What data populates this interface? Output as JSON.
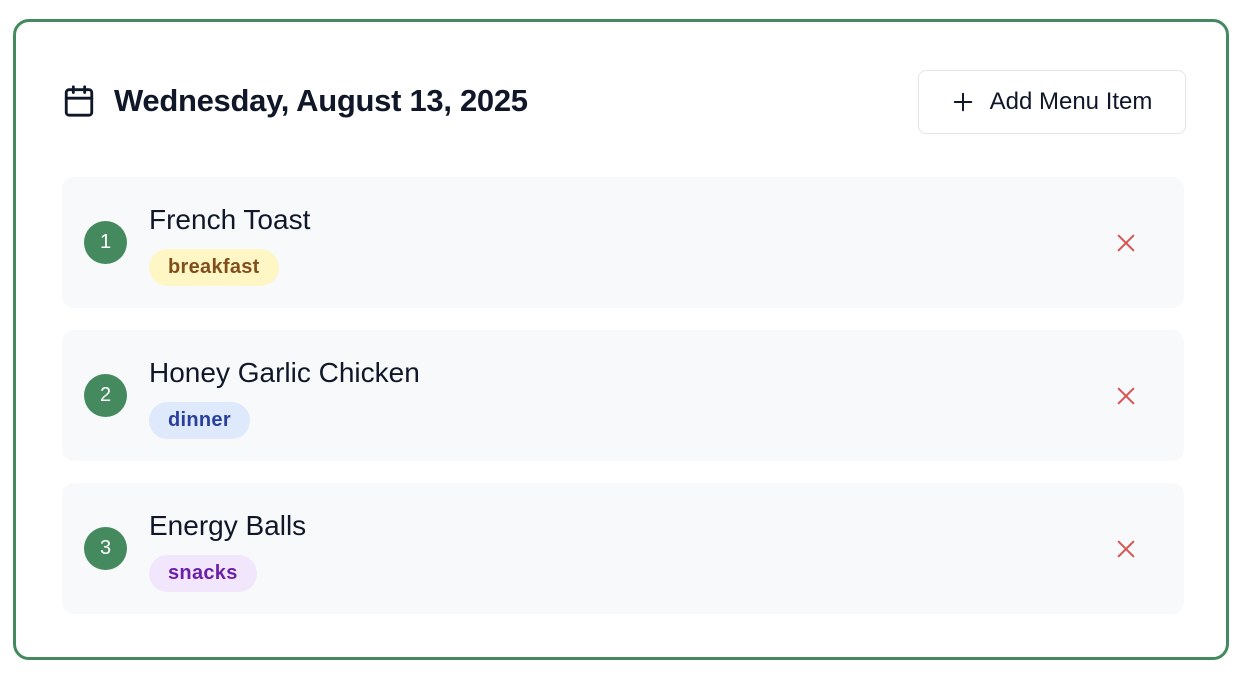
{
  "header": {
    "date": "Wednesday, August 13, 2025",
    "add_button_label": "Add Menu Item",
    "calendar_icon": "calendar-icon",
    "add_icon": "plus-icon"
  },
  "menu_items": [
    {
      "number": "1",
      "name": "French Toast",
      "category": "breakfast"
    },
    {
      "number": "2",
      "name": "Honey Garlic Chicken",
      "category": "dinner"
    },
    {
      "number": "3",
      "name": "Energy Balls",
      "category": "snacks"
    }
  ],
  "colors": {
    "accent": "#448a5e",
    "remove": "#d9534f",
    "breakfast_bg": "#fef6c4",
    "breakfast_text": "#7f4f1d",
    "dinner_bg": "#dfe9fc",
    "dinner_text": "#2a3f9a",
    "snacks_bg": "#f2e6fd",
    "snacks_text": "#6b21a8"
  },
  "remove_icon": "close-icon"
}
